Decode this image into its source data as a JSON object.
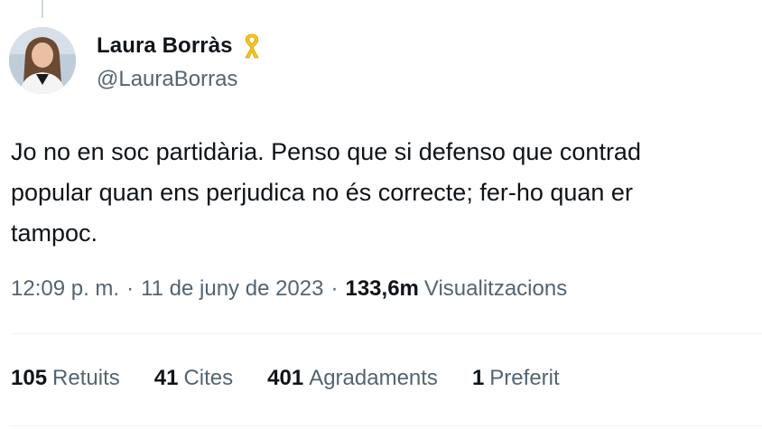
{
  "author": {
    "display_name": "Laura Borràs",
    "handle": "@LauraBorras",
    "badge_icon": "yellow-ribbon-icon",
    "badge_color": "#f5c518"
  },
  "tweet": {
    "lines": [
      "Jo no en soc partidària. Penso que si defenso que contrad",
      "popular quan ens perjudica no és correcte; fer-ho quan er",
      "tampoc."
    ]
  },
  "meta": {
    "time": "12:09 p. m.",
    "separator": "·",
    "date": "11 de juny de 2023",
    "views_count": "133,6m",
    "views_label": "Visualitzacions"
  },
  "stats": [
    {
      "count": "105",
      "label": "Retuits"
    },
    {
      "count": "41",
      "label": "Cites"
    },
    {
      "count": "401",
      "label": "Agradaments"
    },
    {
      "count": "1",
      "label": "Preferit"
    }
  ],
  "colors": {
    "text_primary": "#0f1419",
    "text_secondary": "#536471",
    "divider": "#eff3f4"
  }
}
